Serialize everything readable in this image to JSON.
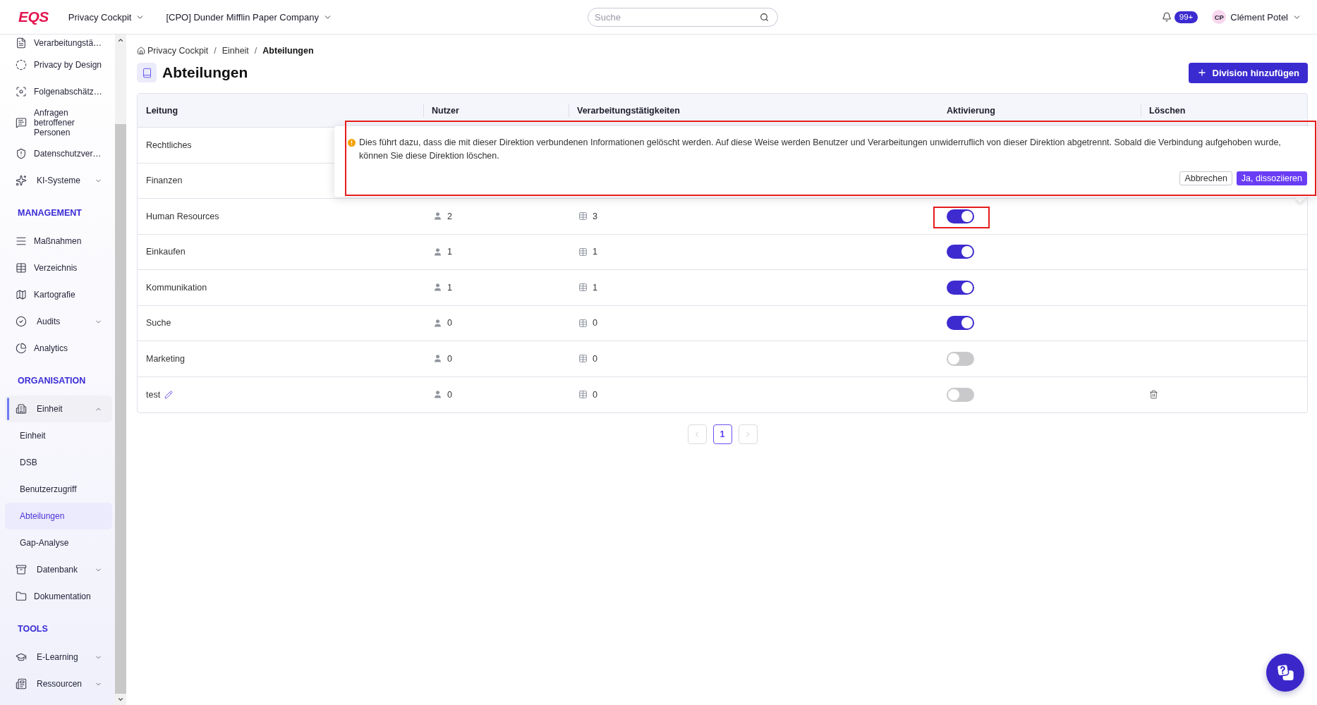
{
  "topbar": {
    "logo": "EQS",
    "module": "Privacy Cockpit",
    "company": "[CPO] Dunder Mifflin Paper Company",
    "search": {
      "placeholder": "Suche"
    },
    "notifications": "99+",
    "user": {
      "initials": "CP",
      "name": "Clément Potel"
    }
  },
  "sidebar": {
    "items": [
      {
        "kind": "link",
        "label": "Verarbeitungstä…",
        "selected": false
      },
      {
        "kind": "link",
        "label": "Privacy by Design",
        "selected": false
      },
      {
        "kind": "link",
        "label": "Folgenabschätz…",
        "selected": false
      },
      {
        "kind": "link",
        "label": "Anfragen betroffener Personen",
        "selected": false
      },
      {
        "kind": "link",
        "label": "Datenschutzver…",
        "selected": false
      },
      {
        "kind": "group",
        "label": "KI-Systeme",
        "selected": false,
        "expanded": false
      },
      {
        "kind": "section",
        "label": "MANAGEMENT"
      },
      {
        "kind": "link",
        "label": "Maßnahmen",
        "selected": false
      },
      {
        "kind": "link",
        "label": "Verzeichnis",
        "selected": false
      },
      {
        "kind": "link",
        "label": "Kartografie",
        "selected": false
      },
      {
        "kind": "group",
        "label": "Audits",
        "selected": false,
        "expanded": false
      },
      {
        "kind": "link",
        "label": "Analytics",
        "selected": false
      },
      {
        "kind": "section",
        "label": "ORGANISATION"
      },
      {
        "kind": "group",
        "label": "Einheit",
        "selected": true,
        "expanded": true,
        "children": [
          {
            "label": "Einheit",
            "selected": false
          },
          {
            "label": "DSB",
            "selected": false
          },
          {
            "label": "Benutzerzugriff",
            "selected": false
          },
          {
            "label": "Abteilungen",
            "selected": true
          },
          {
            "label": "Gap-Analyse",
            "selected": false
          }
        ]
      },
      {
        "kind": "group",
        "label": "Datenbank",
        "selected": false,
        "expanded": false
      },
      {
        "kind": "link",
        "label": "Dokumentation",
        "selected": false
      },
      {
        "kind": "section",
        "label": "TOOLS"
      },
      {
        "kind": "group",
        "label": "E-Learning",
        "selected": false,
        "expanded": false
      },
      {
        "kind": "group",
        "label": "Ressourcen",
        "selected": false,
        "expanded": false
      }
    ]
  },
  "breadcrumb": {
    "separator": "/",
    "items": [
      {
        "kind": "home",
        "label": "Privacy Cockpit",
        "current": false
      },
      {
        "kind": "link",
        "label": "Einheit",
        "current": false
      },
      {
        "kind": "link",
        "label": "Abteilungen",
        "current": true
      }
    ]
  },
  "page": {
    "title": "Abteilungen",
    "add_button": "Division hinzufügen"
  },
  "table": {
    "columns": [
      "Leitung",
      "Nutzer",
      "Verarbeitungstätigkeiten",
      "Aktivierung",
      "Löschen"
    ],
    "rows": [
      {
        "name": "Rechtliches",
        "editable": false
      },
      {
        "name": "Finanzen",
        "editable": false
      },
      {
        "name": "Human Resources",
        "users": "2",
        "activities": "3",
        "active": true,
        "highlighted": true,
        "editable": false,
        "deletable": false
      },
      {
        "name": "Einkaufen",
        "users": "1",
        "activities": "1",
        "active": true,
        "highlighted": false,
        "editable": false,
        "deletable": false
      },
      {
        "name": "Kommunikation",
        "users": "1",
        "activities": "1",
        "active": true,
        "highlighted": false,
        "editable": false,
        "deletable": false
      },
      {
        "name": "Suche",
        "users": "0",
        "activities": "0",
        "active": true,
        "highlighted": false,
        "editable": false,
        "deletable": false
      },
      {
        "name": "Marketing",
        "users": "0",
        "activities": "0",
        "active": false,
        "highlighted": false,
        "editable": false,
        "deletable": false
      },
      {
        "name": "test",
        "users": "0",
        "activities": "0",
        "active": false,
        "highlighted": false,
        "editable": true,
        "deletable": true
      }
    ]
  },
  "popover": {
    "message": "Dies führt dazu, dass die mit dieser Direktion verbundenen Informationen gelöscht werden. Auf diese Weise werden Benutzer und Verarbeitungen unwiderruflich von dieser Direktion abgetrennt. Sobald die Verbindung aufgehoben wurde, können Sie diese Direktion löschen.",
    "cancel": "Abbrechen",
    "confirm": "Ja, dissoziieren",
    "highlighted": true
  },
  "pagination": {
    "previous": {
      "disabled": true
    },
    "pages": [
      {
        "label": "1",
        "selected": true
      }
    ],
    "next": {
      "disabled": true
    }
  }
}
